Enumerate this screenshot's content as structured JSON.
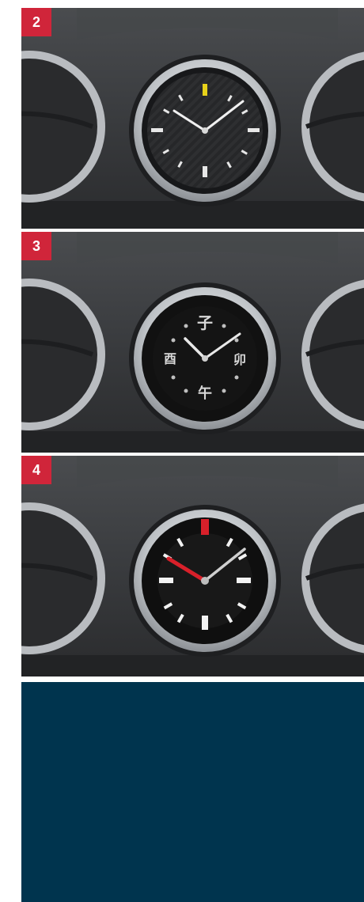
{
  "panels": [
    {
      "number": "2"
    },
    {
      "number": "3",
      "dial_characters": {
        "twelve": "子",
        "three": "卯",
        "six": "午",
        "nine": "酉"
      }
    },
    {
      "number": "4"
    }
  ],
  "colors": {
    "badge": "#d0253a",
    "dashboard": "#3a3c3f",
    "bezel": "#d6d9dc",
    "dial_2": "#2b2c2e",
    "dial_3": "#141414",
    "dial_4": "#181818",
    "accent_yellow": "#e8d21a",
    "accent_red": "#d8202a",
    "blue_block": "#00344e"
  }
}
